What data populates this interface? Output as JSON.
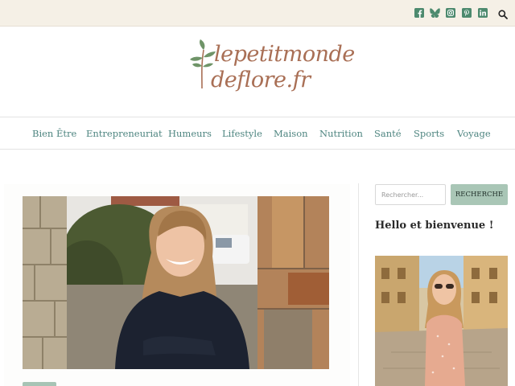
{
  "social": {
    "icons": [
      "facebook-icon",
      "bluesky-icon",
      "instagram-icon",
      "pinterest-icon",
      "linkedin-icon"
    ],
    "search_icon": "search-icon"
  },
  "logo": {
    "line1": "lepetitmonde",
    "line2": "deflore.fr"
  },
  "nav": {
    "items": [
      "Bien Être",
      "Entrepreneuriat",
      "Humeurs",
      "Lifestyle",
      "Maison",
      "Nutrition",
      "Santé",
      "Sports",
      "Voyage"
    ]
  },
  "sidebar": {
    "search_placeholder": "Rechercher...",
    "search_button": "RECHERCHE",
    "welcome_title": "Hello et bienvenue !"
  },
  "colors": {
    "topbar_bg": "#f5f0e6",
    "brand_text": "#a96f55",
    "nav_text": "#4e8580",
    "accent_green": "#a9c6b6",
    "icon_green": "#4d8a6e"
  }
}
